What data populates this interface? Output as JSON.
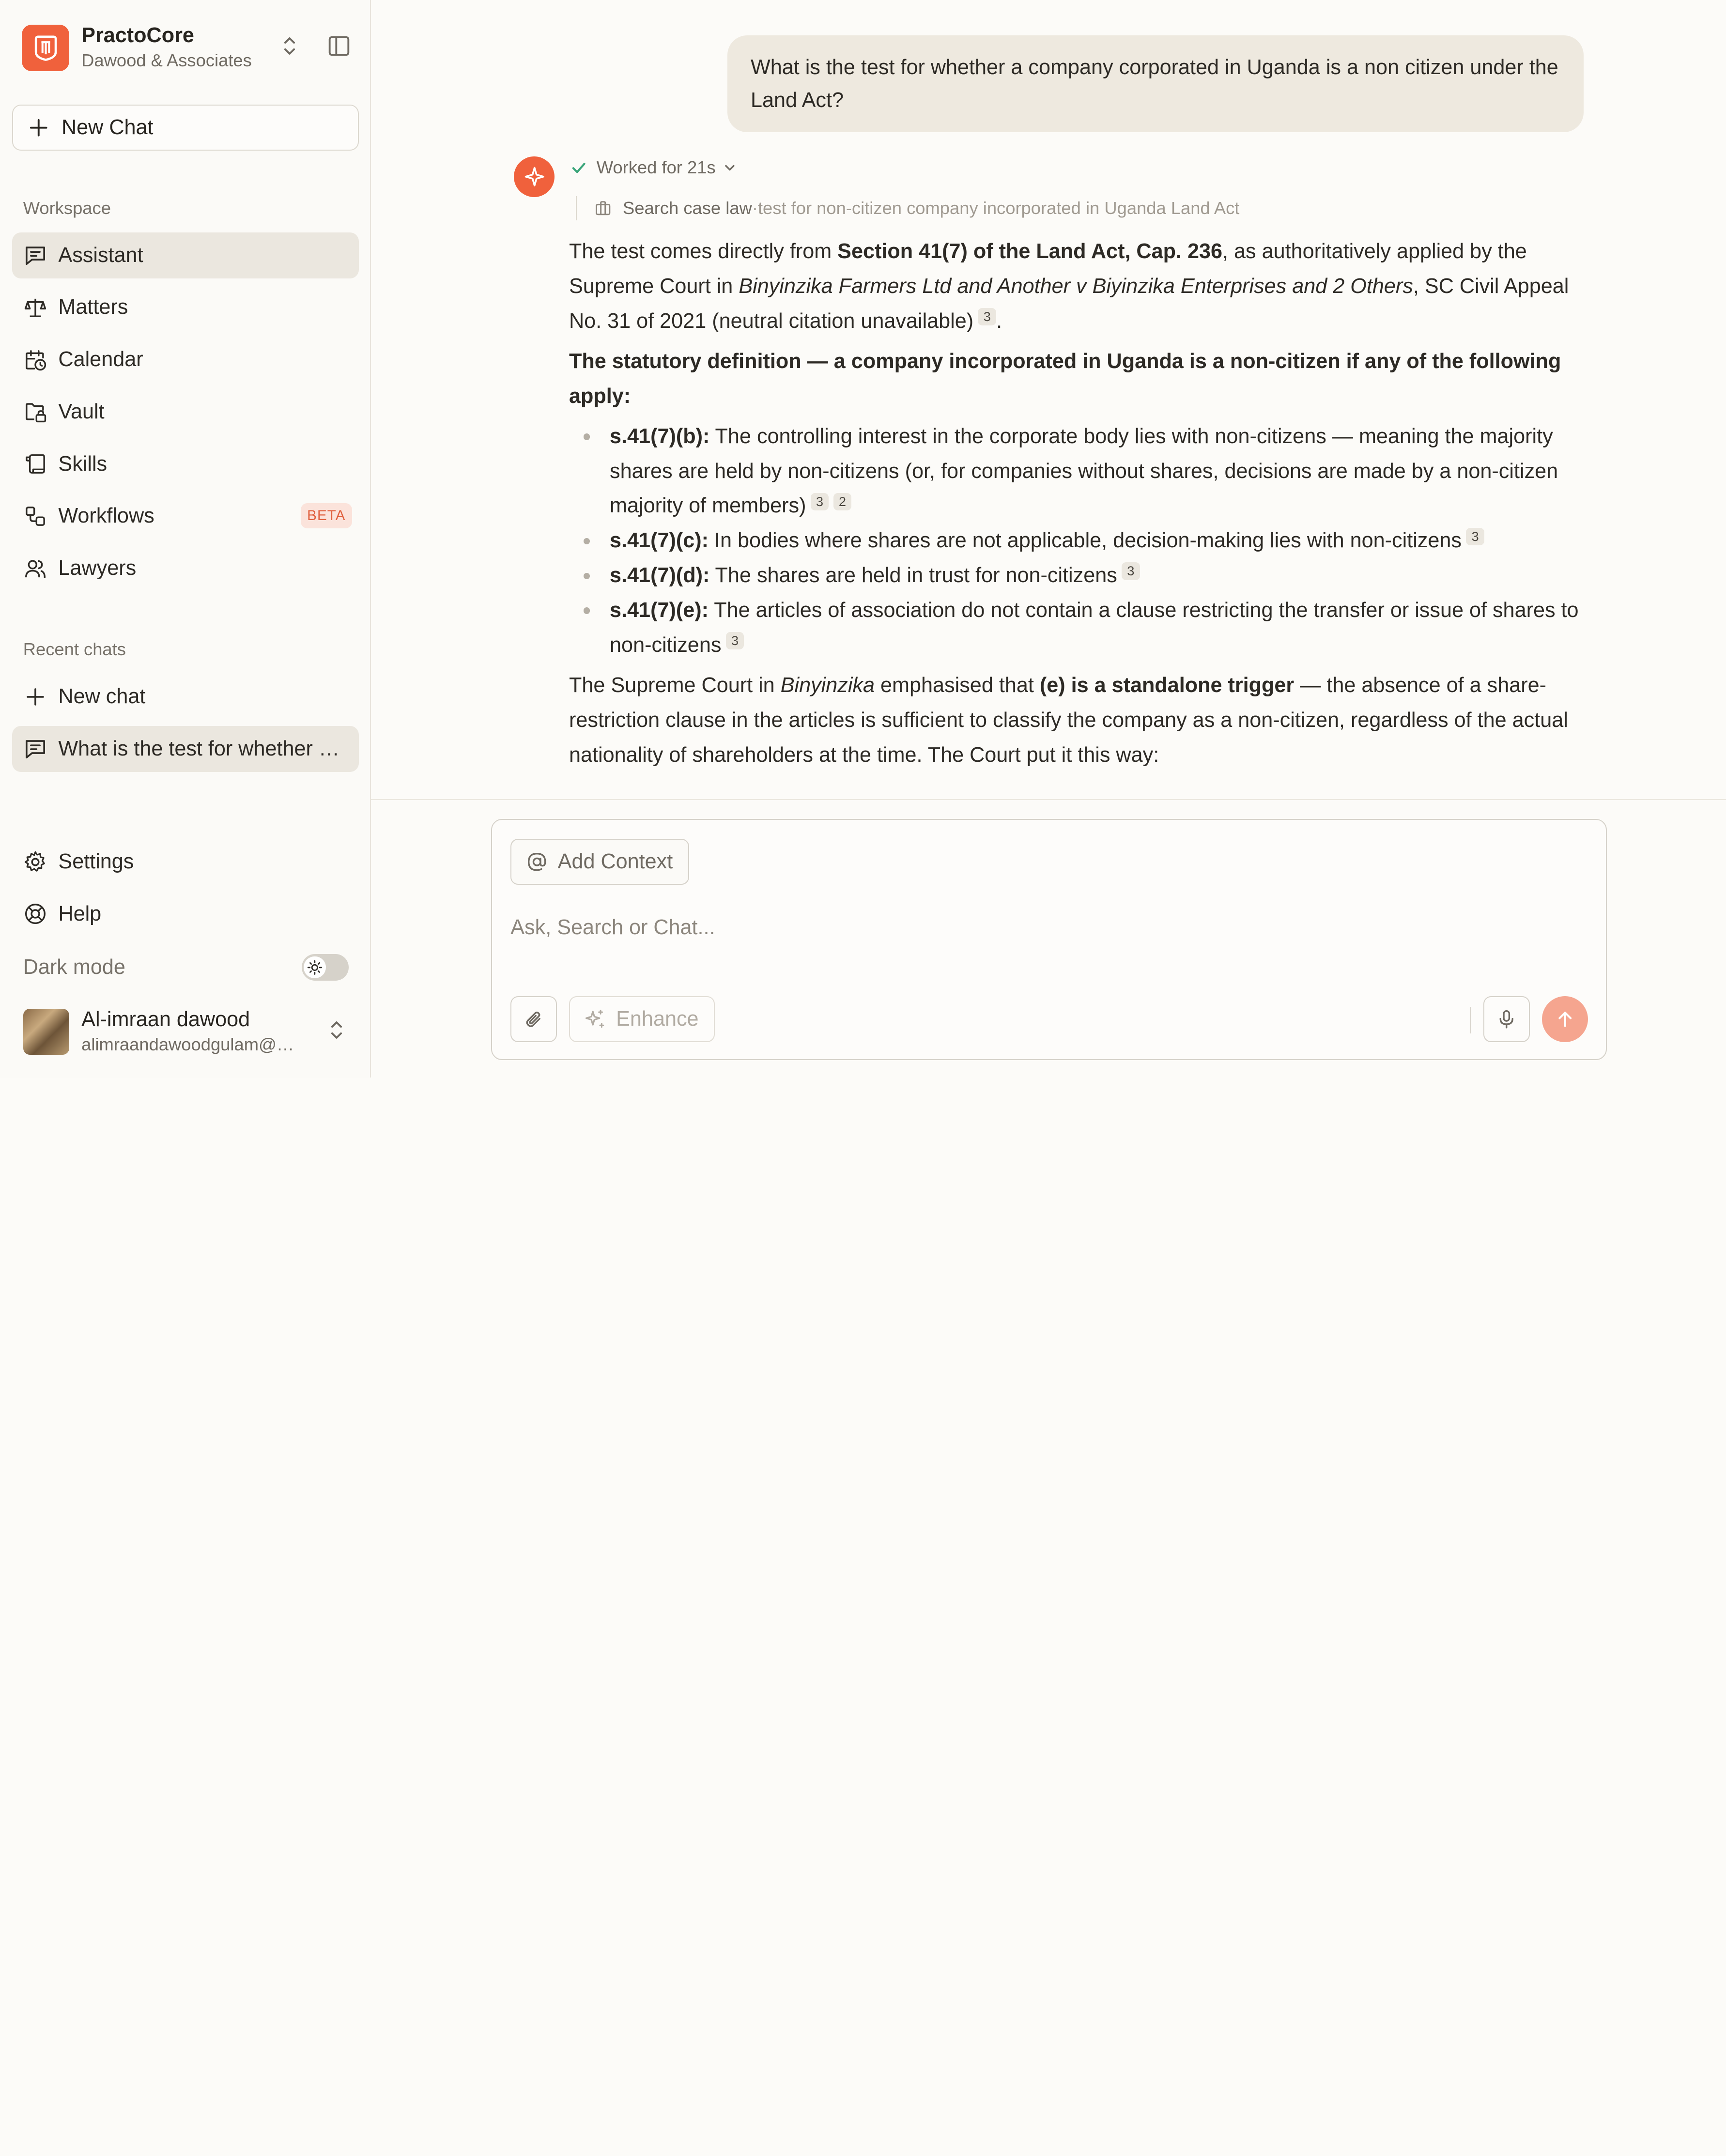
{
  "app": {
    "name": "PractoCore",
    "org": "Dawood & Associates",
    "new_chat_label": "New Chat"
  },
  "sidebar": {
    "workspace_label": "Workspace",
    "items": [
      {
        "label": "Assistant",
        "icon": "message-square-icon"
      },
      {
        "label": "Matters",
        "icon": "scale-icon"
      },
      {
        "label": "Calendar",
        "icon": "calendar-clock-icon"
      },
      {
        "label": "Vault",
        "icon": "folder-lock-icon"
      },
      {
        "label": "Skills",
        "icon": "scroll-icon"
      },
      {
        "label": "Workflows",
        "icon": "workflow-icon",
        "badge": "BETA"
      },
      {
        "label": "Lawyers",
        "icon": "users-icon"
      }
    ],
    "recent_label": "Recent chats",
    "recent_new": "New chat",
    "recent_items": [
      "What is the test for whether a company corporated in Uganda is a non citizen under the Land Act?"
    ],
    "settings": "Settings",
    "help": "Help",
    "dark_mode": "Dark mode",
    "user": {
      "name": "Al-imraan dawood",
      "email": "alimraandawoodgulam@gmail.com"
    }
  },
  "conversation": {
    "user_message": "What is the test for whether a company corporated in Uganda is a non citizen under the Land Act?",
    "worked_label": "Worked for 21s",
    "tool": {
      "name": "Search case law",
      "separator": " · ",
      "query": "test for non-citizen company incorporated in Uganda Land Act"
    },
    "answer": {
      "p1_a": "The test comes directly from ",
      "p1_b": "Section 41(7) of the Land Act, Cap. 236",
      "p1_c": ", as authoritatively applied by the Supreme Court in ",
      "p1_d": "Binyinzika Farmers Ltd and Another v Biyinzika Enterprises and 2 Others",
      "p1_e": ", SC Civil Appeal No. 31 of 2021 (neutral citation unavailable)",
      "p1_cite": "3",
      "p1_end": ".",
      "heading": "The statutory definition — a company incorporated in Uganda is a non-citizen if any of the following apply:",
      "bullets": [
        {
          "key": "s.41(7)(b):",
          "text": " The controlling interest in the corporate body lies with non-citizens — meaning the majority shares are held by non-citizens (or, for companies without shares, decisions are made by a non-citizen majority of members)",
          "cites": [
            "3",
            "2"
          ]
        },
        {
          "key": "s.41(7)(c):",
          "text": " In bodies where shares are not applicable, decision-making lies with non-citizens",
          "cites": [
            "3"
          ]
        },
        {
          "key": "s.41(7)(d):",
          "text": " The shares are held in trust for non-citizens",
          "cites": [
            "3"
          ]
        },
        {
          "key": "s.41(7)(e):",
          "text": " The articles of association do not contain a clause restricting the transfer or issue of shares to non-citizens",
          "cites": [
            "3"
          ]
        }
      ],
      "p3_a": "The Supreme Court in ",
      "p3_b": "Binyinzika",
      "p3_c": " emphasised that ",
      "p3_d": "(e) is a standalone trigger",
      "p3_e": " — the absence of a share-restriction clause in the articles is sufficient to classify the company as a non-citizen, regardless of the actual nationality of shareholders at the time. The Court put it this way:"
    }
  },
  "composer": {
    "add_context": "Add Context",
    "placeholder": "Ask, Search or Chat...",
    "enhance": "Enhance"
  },
  "colors": {
    "accent": "#f0613c",
    "background": "#fcfbf8",
    "active_nav": "#ebe7df",
    "send_button": "#f5a58f"
  }
}
